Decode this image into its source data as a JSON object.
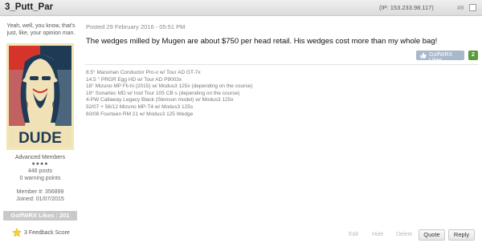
{
  "header": {
    "username": "3_Putt_Par",
    "ip": "(IP: 153.233.98.117)",
    "post_number": "#8"
  },
  "sidebar": {
    "tagline": "Yeah, well, you know, that's just, like, your opinion man.",
    "avatar_caption": "DUDE",
    "rank": "Advanced Members",
    "rank_dots": "●●●●",
    "posts": "446 posts",
    "warnings": "0 warning points",
    "member_no": "Member #: 356899",
    "joined": "Joined: 01/07/2015",
    "likes": "GolfWRX Likes : 201",
    "feedback": "3 Feedback Score"
  },
  "post": {
    "posted": "Posted 29 February 2016 - 05:51 PM",
    "message": "The wedges milled by Mugen are about $750 per head retail.  His wedges cost more than my whole bag!",
    "like_label": "GolfWRX Likes",
    "like_count": "2"
  },
  "signature": [
    "8.5° Maruman Conductor Pro-x w/ Tour AD GT-7x",
    "14.5 °  PRGR Egg HD w/ Tour AD P9003x",
    "18°   Mizuno MP Fli-hi (2015) w/ Modus3 125x  (depending on the course)",
    "19°   Sonartec MD w/ Irod Tour 105 CB s  (depending on the course)",
    "4-PW  Callaway Legacy Black (Stenson model) w/ Modus3 125x",
    "52/07 + 56/12  Mizuno MP-T4 w/ Modus3 125s",
    "60/08  Fourteen RM 21 w/ Modus3 125 Wedge"
  ],
  "actions": {
    "edit": "Edit",
    "hide": "Hide",
    "delete": "Delete",
    "quote": "Quote",
    "reply": "Reply"
  },
  "colors": {
    "header_bg": "#e4e4e4",
    "like_button": "#a8b9cc",
    "like_count_bg": "#5a9a3c",
    "avatar_red": "#d6332a",
    "avatar_navy": "#1f3a55",
    "avatar_cream": "#f2e6b5"
  }
}
